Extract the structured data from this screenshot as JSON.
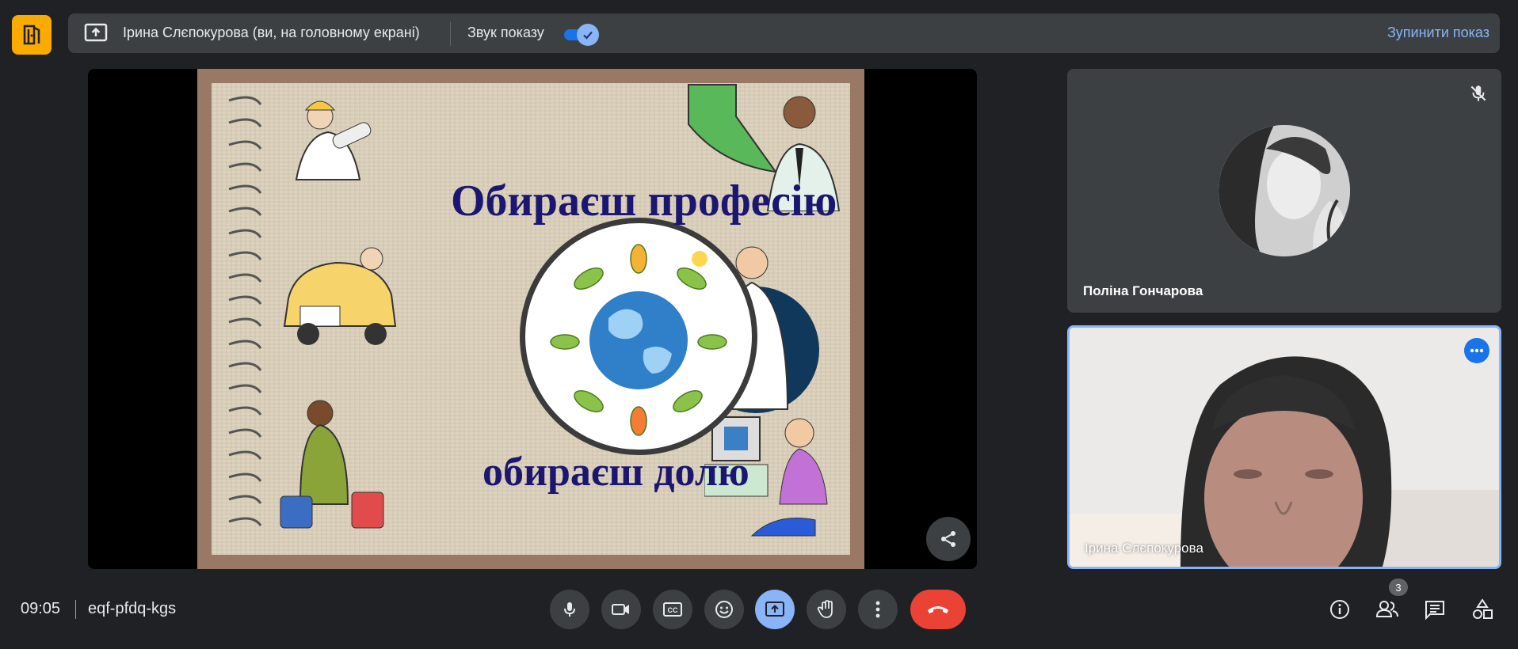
{
  "topbar": {
    "presenter_text": "Ірина Слєпокурова (ви, на головному екрані)",
    "sound_label": "Звук показу",
    "sound_enabled": true,
    "stop_label": "Зупинити показ"
  },
  "slide": {
    "title_1": "Обираєш професію",
    "title_2": "обираєш долю"
  },
  "participants": [
    {
      "name": "Поліна Гончарова",
      "muted": true
    },
    {
      "name": "Ірина Слєпокурова",
      "active": true
    }
  ],
  "bottombar": {
    "time": "09:05",
    "meeting_code": "eqf-pfdq-kgs",
    "people_count": "3"
  },
  "colors": {
    "background": "#202124",
    "panel": "#3c4043",
    "accent": "#8ab4f8",
    "leave": "#ea4335",
    "logo": "#f9ab00",
    "slide_title": "#1b1770"
  }
}
